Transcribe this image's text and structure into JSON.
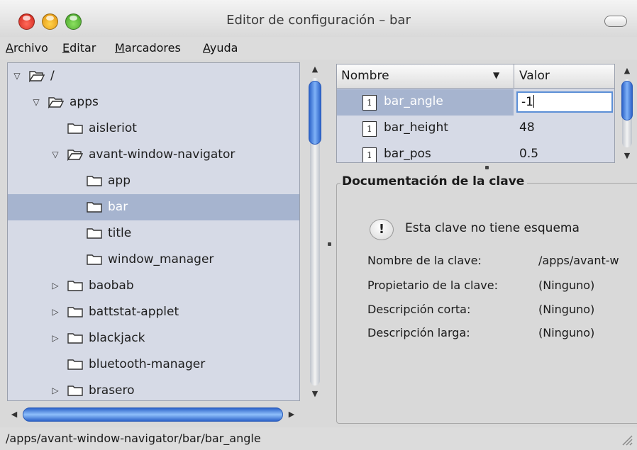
{
  "window": {
    "title": "Editor de configuración – bar"
  },
  "menu": [
    "Archivo",
    "Editar",
    "Marcadores",
    "Ayuda"
  ],
  "tree": [
    {
      "label": "/",
      "depth": 0,
      "expanded": true,
      "expander": true
    },
    {
      "label": "apps",
      "depth": 1,
      "expanded": true,
      "expander": true
    },
    {
      "label": "aisleriot",
      "depth": 2,
      "expanded": false,
      "expander": false
    },
    {
      "label": "avant-window-navigator",
      "depth": 2,
      "expanded": true,
      "expander": true
    },
    {
      "label": "app",
      "depth": 3,
      "expanded": false,
      "expander": false
    },
    {
      "label": "bar",
      "depth": 3,
      "expanded": false,
      "expander": false,
      "selected": true
    },
    {
      "label": "title",
      "depth": 3,
      "expanded": false,
      "expander": false
    },
    {
      "label": "window_manager",
      "depth": 3,
      "expanded": false,
      "expander": false
    },
    {
      "label": "baobab",
      "depth": 2,
      "expanded": false,
      "expander": true
    },
    {
      "label": "battstat-applet",
      "depth": 2,
      "expanded": false,
      "expander": true
    },
    {
      "label": "blackjack",
      "depth": 2,
      "expanded": false,
      "expander": true
    },
    {
      "label": "bluetooth-manager",
      "depth": 2,
      "expanded": false,
      "expander": false
    },
    {
      "label": "brasero",
      "depth": 2,
      "expanded": false,
      "expander": true
    }
  ],
  "keylist": {
    "col_name": "Nombre",
    "col_value": "Valor",
    "rows": [
      {
        "name": "bar_angle",
        "value": "-1",
        "selected": true,
        "editing": true
      },
      {
        "name": "bar_height",
        "value": "48"
      },
      {
        "name": "bar_pos",
        "value": "0.5"
      }
    ]
  },
  "doc": {
    "legend": "Documentación de la clave",
    "schema_msg": "Esta clave no tiene esquema",
    "fields": [
      {
        "label": "Nombre de la clave:",
        "value": "/apps/avant-w"
      },
      {
        "label": "Propietario de la clave:",
        "value": "(Ninguno)"
      },
      {
        "label": "Descripción corta:",
        "value": "(Ninguno)"
      },
      {
        "label": "Descripción larga:",
        "value": "(Ninguno)"
      }
    ]
  },
  "status": {
    "path": "/apps/avant-window-navigator/bar/bar_angle"
  },
  "colors": {
    "selection": "#a6b4cf",
    "scroll_thumb": "#2d63c9",
    "pane_bg": "#d6dae6"
  },
  "icons": {
    "tree": "folder-icon",
    "key": "integer-key-icon",
    "warning": "warning-icon"
  }
}
